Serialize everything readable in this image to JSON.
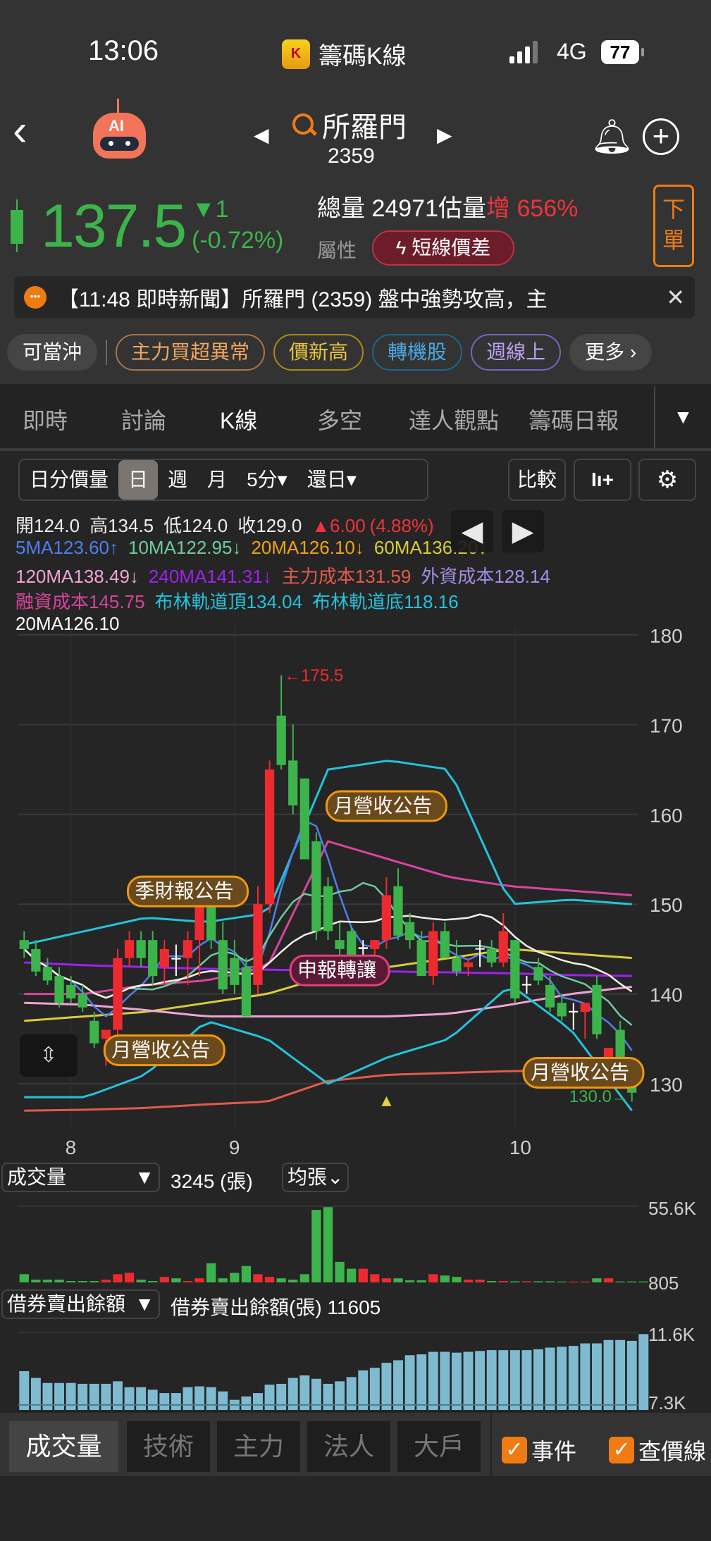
{
  "status": {
    "time": "13:06",
    "app": "籌碼K線",
    "network": "4G",
    "battery": "77"
  },
  "header": {
    "ai_label": "AI",
    "stock_name": "所羅門",
    "stock_code": "2359"
  },
  "quote": {
    "price": "137.5",
    "change": "▼1",
    "change_pct": "(-0.72%)",
    "volume_label": "總量",
    "volume": "24971",
    "est_label": "估量",
    "est_dir": "增",
    "est_pct": "656%",
    "attr_label": "屬性",
    "attr_badge": "短線價差",
    "order_label": "下單"
  },
  "news": {
    "text": "【11:48 即時新聞】所羅門 (2359) 盤中強勢攻高，主",
    "close": "✕"
  },
  "tags": [
    {
      "label": "可當沖",
      "color": "#ffffff",
      "border": "#444444"
    },
    {
      "label": "主力買超異常",
      "color": "#f2a761",
      "border": "#a9744b"
    },
    {
      "label": "價新高",
      "color": "#e7c53d",
      "border": "#a98a16"
    },
    {
      "label": "轉機股",
      "color": "#4aa7e3",
      "border": "#1d6690"
    },
    {
      "label": "週線上",
      "color": "#b9a2ef",
      "border": "#7a62c4"
    },
    {
      "label": "更多 ›",
      "color": "#ffffff",
      "border": "#444444"
    }
  ],
  "tabs": [
    "即時",
    "討論",
    "K線",
    "多空",
    "達人觀點",
    "籌碼日報"
  ],
  "active_tab": "K線",
  "toolbar": {
    "periods": [
      "日分價量",
      "日",
      "週",
      "月",
      "5分▾",
      "還日▾"
    ],
    "active": "日",
    "compare": "比較"
  },
  "legend": {
    "ohlc": {
      "open": "開124.0",
      "high": "高134.5",
      "low": "低124.0",
      "close": "收129.0",
      "chg": "▲6.00",
      "pct": "(4.88%)"
    },
    "row2": [
      {
        "t": "5MA123.60↑",
        "c": "#4f7ef0"
      },
      {
        "t": "10MA122.95↓",
        "c": "#6fc9a0"
      },
      {
        "t": "20MA126.10↓",
        "c": "#f0a215"
      },
      {
        "t": "60MA136.20↓",
        "c": "#d8cc3a"
      }
    ],
    "row3": [
      {
        "t": "120MA138.49↓",
        "c": "#f0a3d6"
      },
      {
        "t": "240MA141.31↓",
        "c": "#a020f0"
      },
      {
        "t": "主力成本131.59",
        "c": "#e15b4b"
      },
      {
        "t": "外資成本128.14",
        "c": "#a68ee6"
      }
    ],
    "row4": [
      {
        "t": "融資成本145.75",
        "c": "#d9449d"
      },
      {
        "t": "布林軌道頂134.04",
        "c": "#23c3dc"
      },
      {
        "t": "布林軌道底118.16",
        "c": "#23c3dc"
      }
    ],
    "row5": "20MA126.10"
  },
  "colors": {
    "up": "#ee2a31",
    "down": "#3cb44b",
    "grid": "#3a3a3a",
    "axis": "#cfcfcf"
  },
  "chart_data": [
    {
      "type": "candlestick",
      "title": "K線",
      "ylim": [
        127,
        182
      ],
      "yticks": [
        180,
        170,
        160,
        150,
        140,
        130
      ],
      "xlabels": [
        {
          "label": "8",
          "index": 4
        },
        {
          "label": "9",
          "index": 18
        },
        {
          "label": "10",
          "index": 42
        }
      ],
      "ohlc": [
        [
          146,
          147,
          144,
          145
        ],
        [
          145,
          146,
          142,
          142.5
        ],
        [
          143,
          144,
          141,
          141.5
        ],
        [
          142,
          143,
          138.5,
          139
        ],
        [
          141,
          142,
          139,
          139.5
        ],
        [
          140,
          141,
          138,
          138.5
        ],
        [
          137,
          138,
          134,
          134.5
        ],
        [
          135,
          136,
          132,
          136
        ],
        [
          136,
          145,
          135,
          144
        ],
        [
          144,
          147,
          143,
          146
        ],
        [
          146,
          147,
          143,
          144
        ],
        [
          146,
          147,
          141,
          142
        ],
        [
          143,
          146,
          141,
          145
        ],
        [
          144,
          145.5,
          142,
          144
        ],
        [
          144,
          147,
          141,
          146
        ],
        [
          146,
          151,
          142,
          150
        ],
        [
          152,
          153,
          145,
          146
        ],
        [
          146,
          148,
          140,
          140.5
        ],
        [
          144,
          146,
          140,
          141
        ],
        [
          143,
          144,
          137.5,
          137.5
        ],
        [
          141,
          152,
          140,
          150
        ],
        [
          150,
          166,
          149,
          165
        ],
        [
          171,
          175.5,
          165,
          165.5
        ],
        [
          166,
          170,
          160,
          161
        ],
        [
          164,
          164,
          155,
          155
        ],
        [
          157,
          158,
          146,
          147
        ],
        [
          152,
          153,
          146,
          147
        ],
        [
          146,
          148,
          144,
          145
        ],
        [
          147,
          147.5,
          142,
          143
        ],
        [
          145,
          146,
          143,
          145.2
        ],
        [
          145,
          146,
          143,
          146
        ],
        [
          146,
          153,
          145,
          151
        ],
        [
          152,
          154,
          146,
          146.5
        ],
        [
          148,
          149,
          145,
          146
        ],
        [
          146,
          147,
          142,
          142
        ],
        [
          142,
          148,
          141,
          147
        ],
        [
          147,
          148,
          144,
          144
        ],
        [
          144,
          146,
          142,
          142.5
        ],
        [
          143,
          144,
          142,
          143.5
        ],
        [
          145,
          146,
          143,
          145.1
        ],
        [
          145,
          146,
          143,
          143.5
        ],
        [
          143.5,
          149,
          143,
          147
        ],
        [
          146,
          146,
          139,
          139.5
        ],
        [
          141,
          142,
          140,
          141.1
        ],
        [
          143,
          144,
          141,
          141.5
        ],
        [
          141,
          142,
          138,
          138.5
        ],
        [
          139,
          140,
          137,
          137.5
        ],
        [
          138,
          139,
          136,
          138.1
        ],
        [
          138,
          139,
          135,
          139
        ],
        [
          141,
          142,
          135,
          135.5
        ],
        [
          130,
          134,
          130,
          134
        ],
        [
          136,
          137,
          130,
          131
        ],
        [
          131,
          132,
          128,
          129
        ]
      ],
      "lines": [
        {
          "name": "60MA",
          "color": "#d8cc3a",
          "values": [
            137,
            137.5,
            138,
            139,
            140,
            142,
            143,
            144,
            145,
            144.5,
            144
          ]
        },
        {
          "name": "120MA",
          "color": "#f0a3d6",
          "values": [
            139,
            138.8,
            138.2,
            137.5,
            137.5,
            137.5,
            137.5,
            137.8,
            138.8,
            140,
            140.8
          ]
        },
        {
          "name": "240MA",
          "color": "#a020f0",
          "values": [
            143.5,
            143.2,
            143,
            142.8,
            142.7,
            142.6,
            142.5,
            142.4,
            142.3,
            142.1,
            142
          ]
        },
        {
          "name": "主力成本",
          "color": "#e15b4b",
          "values": [
            127,
            127.1,
            127.3,
            127.7,
            128,
            130.3,
            131,
            131.2,
            131.4,
            131.5,
            131.6
          ]
        },
        {
          "name": "融資成本",
          "color": "#d9449d",
          "values": [
            140,
            140,
            141,
            141.5,
            143,
            157,
            155,
            153,
            152,
            151.5,
            151
          ]
        },
        {
          "name": "布林軌道頂",
          "color": "#23c3dc",
          "values": [
            145.5,
            147,
            148.5,
            148,
            149,
            165,
            166,
            165,
            150,
            150.5,
            150
          ]
        },
        {
          "name": "布林軌道底",
          "color": "#23c3dc",
          "values": [
            128.5,
            128.5,
            131,
            137,
            135,
            130,
            133,
            135,
            141,
            136,
            127
          ]
        }
      ],
      "computed_ma": [
        {
          "name": "5MA",
          "color": "#4f7ef0",
          "period": 5
        },
        {
          "name": "10MA",
          "color": "#6fc9a0",
          "period": 10
        },
        {
          "name": "20MA",
          "color": "#f5f0e6",
          "period": 20
        }
      ],
      "annotations": [
        {
          "label": "季財報公告",
          "index": 14,
          "price": 151.5,
          "style": "orange"
        },
        {
          "label": "月營收公告",
          "index": 12,
          "price": 133.8,
          "style": "orange"
        },
        {
          "label": "月營收公告",
          "index": 31,
          "price": 161,
          "style": "orange"
        },
        {
          "label": "申報轉讓",
          "index": 27,
          "price": 142.7,
          "style": "pink"
        },
        {
          "label": "月營收公告",
          "index": 50,
          "price": 131.3,
          "style": "orange"
        }
      ],
      "high_label": "←175.5",
      "low_label": "130.0→"
    },
    {
      "type": "bar",
      "title": "成交量",
      "value_label": "3245 (張)",
      "unit_btn": "均張",
      "ylim_labels": [
        "55.6K",
        "805"
      ],
      "ymax": 55.6,
      "values": [
        6,
        2,
        2,
        2,
        1,
        1,
        1,
        2,
        6,
        7,
        2,
        1,
        4,
        3,
        1,
        3,
        14,
        3,
        7,
        12,
        6,
        4,
        3,
        2,
        6,
        53,
        55,
        15,
        10,
        10,
        6,
        3,
        3,
        1.5,
        1.5,
        6,
        5,
        4,
        2,
        2,
        1,
        1,
        0.8,
        0.8,
        0.8,
        0.8,
        0.6,
        0.6,
        0.6,
        3,
        3,
        0.7,
        0.7,
        0.7
      ]
    },
    {
      "type": "bar",
      "title": "借券賣出餘額",
      "value_label": "借券賣出餘額(張) 11605",
      "ylim_labels": [
        "11.6K",
        "7.3K"
      ],
      "ymin": 7.0,
      "ymax": 11.6,
      "values": [
        9.3,
        8.9,
        8.6,
        8.6,
        8.6,
        8.55,
        8.55,
        8.55,
        8.7,
        8.35,
        8.35,
        8.2,
        8.0,
        8.0,
        8.35,
        8.4,
        8.35,
        8.1,
        7.6,
        7.8,
        8.0,
        8.5,
        8.55,
        8.9,
        9.05,
        8.85,
        8.55,
        8.7,
        8.95,
        9.35,
        9.5,
        9.8,
        9.95,
        10.25,
        10.3,
        10.45,
        10.45,
        10.4,
        10.45,
        10.5,
        10.55,
        10.55,
        10.55,
        10.55,
        10.6,
        10.7,
        10.75,
        10.8,
        10.95,
        10.95,
        11.15,
        11.15,
        11.1,
        11.5
      ]
    }
  ],
  "bottom": {
    "tabs": [
      "成交量",
      "技術",
      "主力",
      "法人",
      "大戶"
    ],
    "active": "成交量",
    "checks": [
      "事件",
      "查價線"
    ]
  }
}
